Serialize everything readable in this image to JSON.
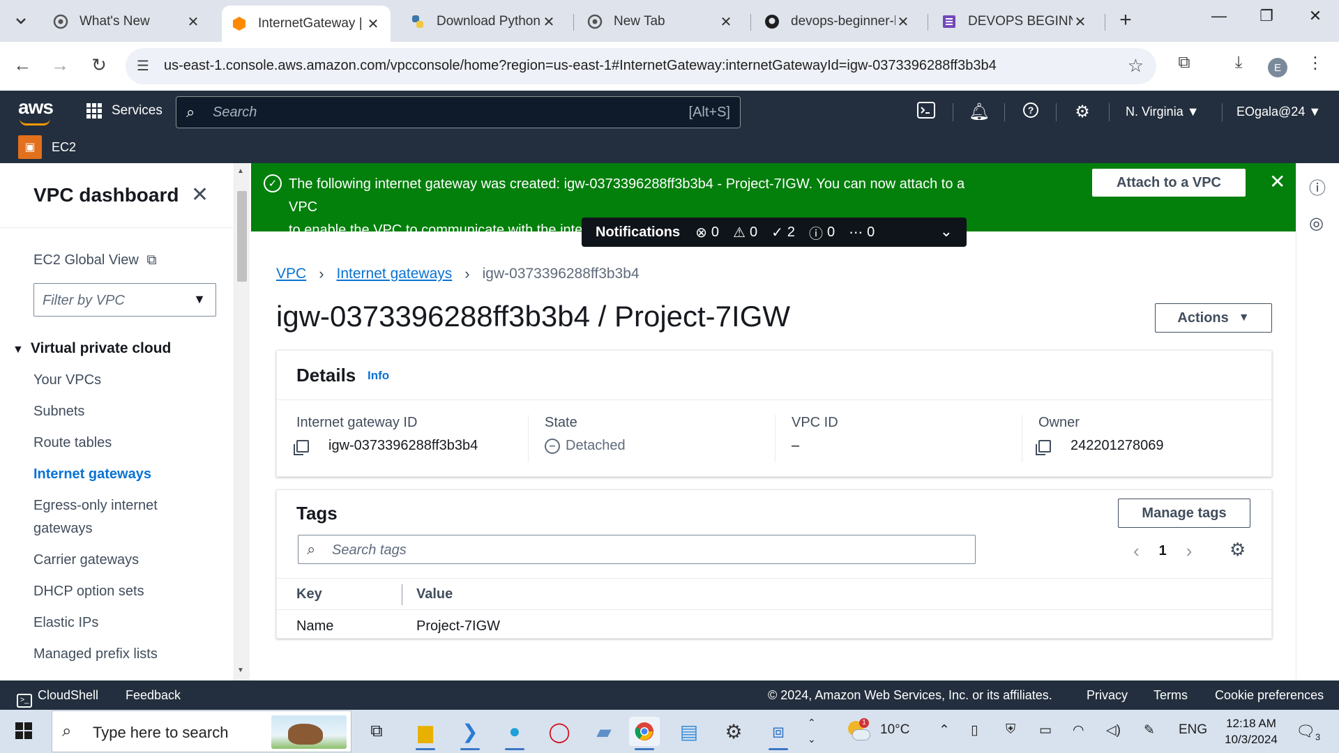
{
  "browser": {
    "tabs": [
      {
        "title": "What's New",
        "icon": "chrome-icon"
      },
      {
        "title": "InternetGateway | V",
        "icon": "aws-icon",
        "active": true
      },
      {
        "title": "Download Python",
        "icon": "python-icon"
      },
      {
        "title": "New Tab",
        "icon": "chrome-icon"
      },
      {
        "title": "devops-beginner-l",
        "icon": "github-icon"
      },
      {
        "title": "DEVOPS BEGINNER",
        "icon": "forms-icon"
      }
    ],
    "url": "us-east-1.console.aws.amazon.com/vpcconsole/home?region=us-east-1#InternetGateway:internetGatewayId=igw-0373396288ff3b3b4",
    "profile_initial": "E"
  },
  "aws_header": {
    "logo": "aws",
    "services_label": "Services",
    "search_placeholder": "Search",
    "search_shortcut": "[Alt+S]",
    "region": "N. Virginia",
    "account": "EOgala@24",
    "service_name": "EC2"
  },
  "sidebar": {
    "title": "VPC dashboard",
    "global_view": "EC2 Global View",
    "filter_placeholder": "Filter by VPC",
    "section": "Virtual private cloud",
    "items": [
      {
        "label": "Your VPCs"
      },
      {
        "label": "Subnets"
      },
      {
        "label": "Route tables"
      },
      {
        "label": "Internet gateways",
        "active": true
      },
      {
        "label": "Egress-only internet"
      },
      {
        "label": "gateways"
      },
      {
        "label": "Carrier gateways"
      },
      {
        "label": "DHCP option sets"
      },
      {
        "label": "Elastic IPs"
      },
      {
        "label": "Managed prefix lists"
      }
    ]
  },
  "flash": {
    "message_line1": "The following internet gateway was created: igw-0373396288ff3b3b4 - Project-7IGW. You can now attach to a VPC",
    "message_line2": "to enable the VPC to communicate with the internet.",
    "action_label": "Attach to a VPC",
    "color": "#037f0c"
  },
  "notifications": {
    "title": "Notifications",
    "errors": "0",
    "warnings": "0",
    "success": "2",
    "info": "0",
    "in_progress": "0"
  },
  "breadcrumb": {
    "root": "VPC",
    "parent": "Internet gateways",
    "current": "igw-0373396288ff3b3b4"
  },
  "page": {
    "title": "igw-0373396288ff3b3b4 / Project-7IGW",
    "actions_label": "Actions"
  },
  "details": {
    "heading": "Details",
    "info_label": "Info",
    "fields": [
      {
        "label": "Internet gateway ID",
        "value": "igw-0373396288ff3b3b4"
      },
      {
        "label": "State",
        "value": "Detached"
      },
      {
        "label": "VPC ID",
        "value": "–"
      },
      {
        "label": "Owner",
        "value": "242201278069"
      }
    ]
  },
  "tags": {
    "heading": "Tags",
    "manage_label": "Manage tags",
    "search_placeholder": "Search tags",
    "page": "1",
    "columns": [
      "Key",
      "Value"
    ],
    "rows": [
      {
        "key": "Name",
        "value": "Project-7IGW"
      }
    ]
  },
  "footer": {
    "cloudshell": "CloudShell",
    "feedback": "Feedback",
    "copyright": "© 2024, Amazon Web Services, Inc. or its affiliates.",
    "privacy": "Privacy",
    "terms": "Terms",
    "cookies": "Cookie preferences"
  },
  "taskbar": {
    "search_placeholder": "Type here to search",
    "temperature": "10°C",
    "language": "ENG",
    "time": "12:18 AM",
    "date": "10/3/2024",
    "notification_count": "3",
    "weather_badge": "1"
  }
}
